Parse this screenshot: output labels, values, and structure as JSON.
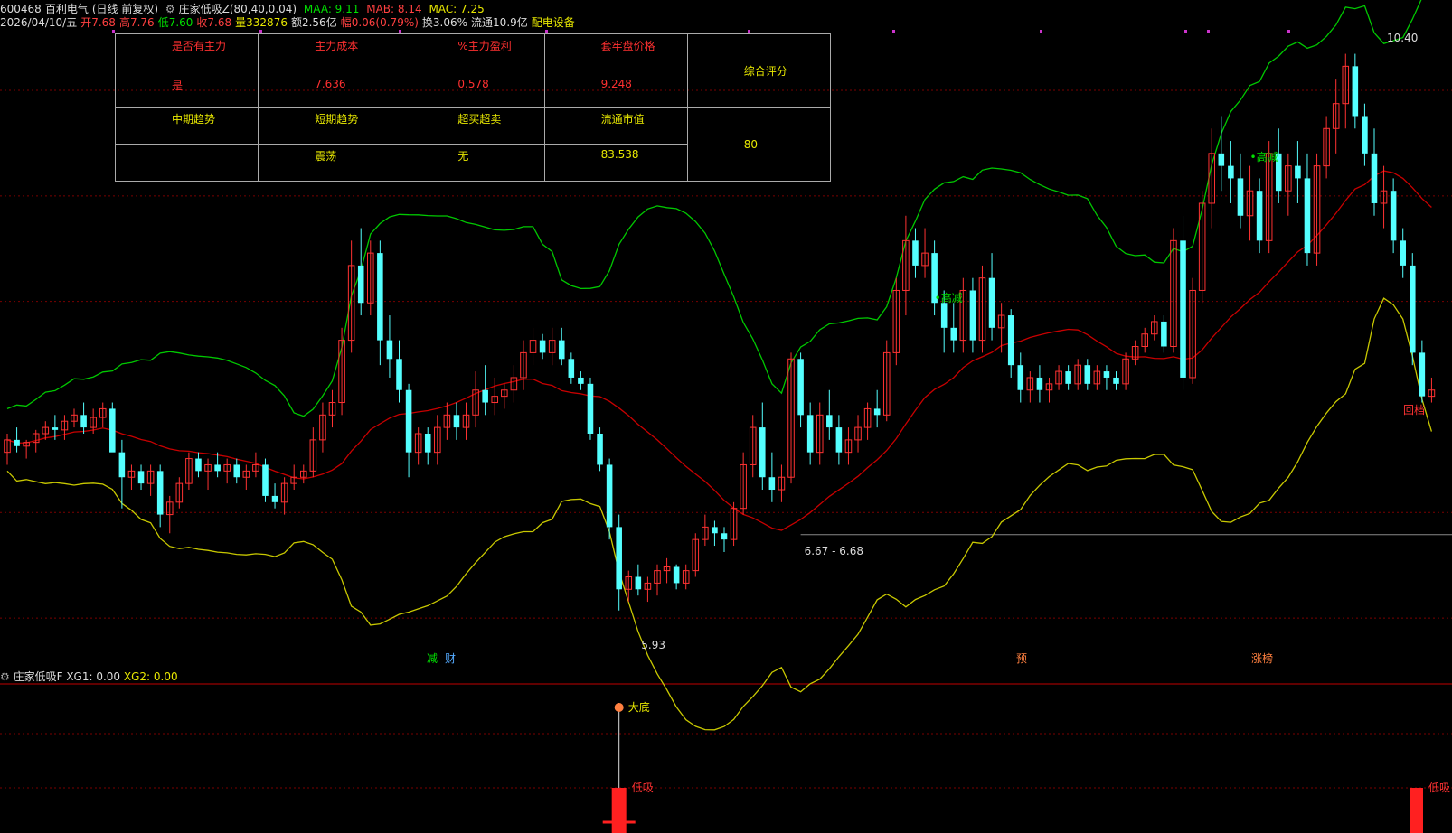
{
  "header": {
    "line1": {
      "code": "600468",
      "name": "百利电气",
      "period": "(日线 前复权)",
      "indicator": "庄家低吸Z(80,40,0.04)",
      "maa": "MAA: 9.11",
      "mab": "MAB: 8.14",
      "mac": "MAC: 7.25"
    },
    "line2": {
      "date": "2026/04/10/五",
      "open": "开7.68",
      "high": "高7.76",
      "low": "低7.60",
      "close": "收7.68",
      "volume": "量332876",
      "amount": "额2.56亿",
      "change": "幅0.06(0.79%)",
      "turnover": "换3.06%",
      "float_cap": "流通10.9亿",
      "industry": "配电设备"
    }
  },
  "info_table": {
    "headers": [
      "是否有主力",
      "主力成本",
      "%主力盈利",
      "套牢盘价格"
    ],
    "values": [
      "是",
      "7.636",
      "0.578",
      "9.248"
    ],
    "row3": [
      "中期趋势",
      "短期趋势",
      "超买超卖",
      "流通市值"
    ],
    "row4": [
      "",
      "震荡",
      "无",
      "83.538"
    ],
    "score_label": "综合评分",
    "score_value": "80"
  },
  "annotations": {
    "high_label": "10.40",
    "low_label": "5.93",
    "range_label": "6.67 - 6.68",
    "signal_gaojian": "高减",
    "signal_gaojian2": "高减",
    "tag_jian": "减",
    "tag_cai": "财",
    "tag_yu": "预",
    "tag_zhangbang": "涨榜",
    "tag_right": "回档",
    "dadi": "大底",
    "dixi": "低吸",
    "dixi2": "低吸"
  },
  "subchart": {
    "name": "庄家低吸F",
    "xg1": "XG1: 0.00",
    "xg2": "XG2: 0.00"
  },
  "colors": {
    "up": "#ff3232",
    "down": "#54ffff",
    "upper_band": "#00c800",
    "mid_band": "#c80000",
    "lower_band": "#c8c800",
    "grid": "#7a0000"
  },
  "chart_data": {
    "type": "candlestick",
    "y_range": [
      5.5,
      10.6
    ],
    "candles": [
      [
        7.2,
        7.35,
        7.1,
        7.3
      ],
      [
        7.3,
        7.4,
        7.2,
        7.25
      ],
      [
        7.25,
        7.3,
        7.15,
        7.28
      ],
      [
        7.28,
        7.38,
        7.2,
        7.35
      ],
      [
        7.35,
        7.45,
        7.3,
        7.4
      ],
      [
        7.4,
        7.5,
        7.3,
        7.38
      ],
      [
        7.38,
        7.5,
        7.3,
        7.45
      ],
      [
        7.45,
        7.55,
        7.4,
        7.5
      ],
      [
        7.5,
        7.6,
        7.35,
        7.4
      ],
      [
        7.4,
        7.55,
        7.35,
        7.48
      ],
      [
        7.48,
        7.6,
        7.4,
        7.55
      ],
      [
        7.55,
        7.6,
        7.3,
        7.2
      ],
      [
        7.2,
        7.3,
        6.75,
        7.0
      ],
      [
        7.0,
        7.1,
        6.9,
        7.05
      ],
      [
        7.05,
        7.1,
        6.9,
        6.95
      ],
      [
        6.95,
        7.1,
        6.85,
        7.05
      ],
      [
        7.05,
        7.1,
        6.6,
        6.7
      ],
      [
        6.7,
        6.85,
        6.55,
        6.8
      ],
      [
        6.8,
        7.0,
        6.75,
        6.95
      ],
      [
        6.95,
        7.2,
        6.9,
        7.15
      ],
      [
        7.15,
        7.2,
        7.0,
        7.05
      ],
      [
        7.05,
        7.15,
        6.9,
        7.1
      ],
      [
        7.1,
        7.2,
        7.0,
        7.05
      ],
      [
        7.05,
        7.15,
        6.95,
        7.1
      ],
      [
        7.1,
        7.15,
        6.95,
        7.0
      ],
      [
        7.0,
        7.1,
        6.9,
        7.05
      ],
      [
        7.05,
        7.2,
        7.0,
        7.1
      ],
      [
        7.1,
        7.15,
        6.8,
        6.85
      ],
      [
        6.85,
        6.95,
        6.75,
        6.8
      ],
      [
        6.8,
        7.0,
        6.7,
        6.95
      ],
      [
        6.95,
        7.1,
        6.9,
        7.0
      ],
      [
        7.0,
        7.1,
        6.95,
        7.05
      ],
      [
        7.05,
        7.4,
        7.0,
        7.3
      ],
      [
        7.3,
        7.6,
        7.2,
        7.5
      ],
      [
        7.5,
        7.7,
        7.4,
        7.6
      ],
      [
        7.6,
        8.2,
        7.5,
        8.1
      ],
      [
        8.1,
        8.9,
        8.0,
        8.7
      ],
      [
        8.7,
        9.0,
        8.3,
        8.4
      ],
      [
        8.4,
        8.9,
        8.3,
        8.8
      ],
      [
        8.8,
        8.9,
        7.9,
        8.1
      ],
      [
        8.1,
        8.3,
        7.8,
        7.95
      ],
      [
        7.95,
        8.1,
        7.6,
        7.7
      ],
      [
        7.7,
        7.75,
        7.0,
        7.2
      ],
      [
        7.2,
        7.4,
        7.1,
        7.35
      ],
      [
        7.35,
        7.4,
        7.1,
        7.2
      ],
      [
        7.2,
        7.5,
        7.1,
        7.4
      ],
      [
        7.4,
        7.6,
        7.3,
        7.5
      ],
      [
        7.5,
        7.6,
        7.3,
        7.4
      ],
      [
        7.4,
        7.6,
        7.3,
        7.5
      ],
      [
        7.5,
        7.85,
        7.4,
        7.7
      ],
      [
        7.7,
        7.9,
        7.5,
        7.6
      ],
      [
        7.6,
        7.8,
        7.5,
        7.65
      ],
      [
        7.65,
        7.75,
        7.55,
        7.7
      ],
      [
        7.7,
        7.9,
        7.6,
        7.8
      ],
      [
        7.8,
        8.1,
        7.7,
        8.0
      ],
      [
        8.0,
        8.2,
        7.9,
        8.1
      ],
      [
        8.1,
        8.15,
        7.95,
        8.0
      ],
      [
        8.0,
        8.2,
        7.9,
        8.1
      ],
      [
        8.1,
        8.2,
        7.9,
        7.95
      ],
      [
        7.95,
        8.0,
        7.75,
        7.8
      ],
      [
        7.8,
        7.85,
        7.7,
        7.75
      ],
      [
        7.75,
        7.8,
        7.3,
        7.35
      ],
      [
        7.35,
        7.4,
        7.05,
        7.1
      ],
      [
        7.1,
        7.15,
        6.5,
        6.6
      ],
      [
        6.6,
        6.7,
        5.93,
        6.1
      ],
      [
        6.1,
        6.25,
        6.0,
        6.2
      ],
      [
        6.2,
        6.3,
        6.05,
        6.1
      ],
      [
        6.1,
        6.2,
        6.0,
        6.15
      ],
      [
        6.15,
        6.3,
        6.05,
        6.25
      ],
      [
        6.25,
        6.35,
        6.15,
        6.28
      ],
      [
        6.28,
        6.3,
        6.1,
        6.15
      ],
      [
        6.15,
        6.3,
        6.1,
        6.25
      ],
      [
        6.25,
        6.55,
        6.2,
        6.5
      ],
      [
        6.5,
        6.7,
        6.45,
        6.6
      ],
      [
        6.6,
        6.65,
        6.45,
        6.55
      ],
      [
        6.55,
        6.6,
        6.4,
        6.5
      ],
      [
        6.5,
        6.8,
        6.45,
        6.75
      ],
      [
        6.75,
        7.2,
        6.7,
        7.1
      ],
      [
        7.1,
        7.5,
        7.0,
        7.4
      ],
      [
        7.4,
        7.6,
        6.9,
        7.0
      ],
      [
        7.0,
        7.2,
        6.8,
        6.9
      ],
      [
        6.9,
        7.1,
        6.8,
        7.0
      ],
      [
        7.0,
        8.0,
        6.95,
        7.95
      ],
      [
        7.95,
        8.0,
        7.4,
        7.5
      ],
      [
        7.5,
        7.6,
        7.1,
        7.2
      ],
      [
        7.2,
        7.6,
        7.1,
        7.5
      ],
      [
        7.5,
        7.7,
        7.3,
        7.4
      ],
      [
        7.4,
        7.5,
        7.1,
        7.2
      ],
      [
        7.2,
        7.4,
        7.1,
        7.3
      ],
      [
        7.3,
        7.5,
        7.2,
        7.4
      ],
      [
        7.4,
        7.6,
        7.3,
        7.55
      ],
      [
        7.55,
        7.7,
        7.4,
        7.5
      ],
      [
        7.5,
        8.1,
        7.45,
        8.0
      ],
      [
        8.0,
        8.6,
        7.9,
        8.5
      ],
      [
        8.5,
        9.1,
        8.3,
        8.9
      ],
      [
        8.9,
        9.0,
        8.6,
        8.7
      ],
      [
        8.7,
        9.0,
        8.6,
        8.8
      ],
      [
        8.8,
        8.9,
        8.3,
        8.4
      ],
      [
        8.4,
        8.5,
        8.0,
        8.2
      ],
      [
        8.2,
        8.4,
        8.0,
        8.1
      ],
      [
        8.1,
        8.6,
        8.0,
        8.5
      ],
      [
        8.5,
        8.6,
        8.0,
        8.1
      ],
      [
        8.1,
        8.7,
        8.0,
        8.6
      ],
      [
        8.6,
        8.8,
        8.1,
        8.2
      ],
      [
        8.2,
        8.4,
        8.0,
        8.3
      ],
      [
        8.3,
        8.35,
        7.8,
        7.9
      ],
      [
        7.9,
        8.0,
        7.6,
        7.7
      ],
      [
        7.7,
        7.85,
        7.6,
        7.8
      ],
      [
        7.8,
        7.9,
        7.6,
        7.7
      ],
      [
        7.7,
        7.8,
        7.6,
        7.75
      ],
      [
        7.75,
        7.9,
        7.7,
        7.85
      ],
      [
        7.85,
        7.9,
        7.7,
        7.75
      ],
      [
        7.75,
        7.95,
        7.7,
        7.9
      ],
      [
        7.9,
        7.95,
        7.7,
        7.75
      ],
      [
        7.75,
        7.9,
        7.7,
        7.85
      ],
      [
        7.85,
        7.9,
        7.7,
        7.8
      ],
      [
        7.8,
        7.85,
        7.7,
        7.75
      ],
      [
        7.75,
        8.0,
        7.7,
        7.95
      ],
      [
        7.95,
        8.1,
        7.9,
        8.05
      ],
      [
        8.05,
        8.2,
        8.0,
        8.15
      ],
      [
        8.15,
        8.3,
        8.1,
        8.25
      ],
      [
        8.25,
        8.3,
        8.0,
        8.05
      ],
      [
        8.05,
        9.0,
        8.0,
        8.9
      ],
      [
        8.9,
        9.1,
        7.7,
        7.8
      ],
      [
        7.8,
        8.6,
        7.75,
        8.5
      ],
      [
        8.5,
        9.3,
        8.4,
        9.2
      ],
      [
        9.2,
        9.8,
        9.0,
        9.6
      ],
      [
        9.6,
        9.9,
        9.3,
        9.5
      ],
      [
        9.5,
        9.7,
        9.2,
        9.4
      ],
      [
        9.4,
        9.6,
        9.0,
        9.1
      ],
      [
        9.1,
        9.5,
        8.9,
        9.3
      ],
      [
        9.3,
        9.4,
        8.8,
        8.9
      ],
      [
        8.9,
        9.7,
        8.8,
        9.6
      ],
      [
        9.6,
        9.8,
        9.2,
        9.3
      ],
      [
        9.3,
        9.6,
        9.1,
        9.5
      ],
      [
        9.5,
        9.7,
        9.2,
        9.4
      ],
      [
        9.4,
        9.6,
        8.7,
        8.8
      ],
      [
        8.8,
        9.6,
        8.7,
        9.5
      ],
      [
        9.5,
        9.9,
        9.4,
        9.8
      ],
      [
        9.8,
        10.2,
        9.6,
        10.0
      ],
      [
        10.0,
        10.4,
        9.8,
        10.3
      ],
      [
        10.3,
        10.4,
        9.8,
        9.9
      ],
      [
        9.9,
        10.0,
        9.5,
        9.6
      ],
      [
        9.6,
        9.8,
        9.1,
        9.2
      ],
      [
        9.2,
        9.5,
        9.0,
        9.3
      ],
      [
        9.3,
        9.4,
        8.8,
        8.9
      ],
      [
        8.9,
        9.0,
        8.6,
        8.7
      ],
      [
        8.7,
        8.8,
        7.9,
        8.0
      ],
      [
        8.0,
        8.1,
        7.6,
        7.65
      ],
      [
        7.65,
        7.8,
        7.6,
        7.7
      ]
    ]
  }
}
